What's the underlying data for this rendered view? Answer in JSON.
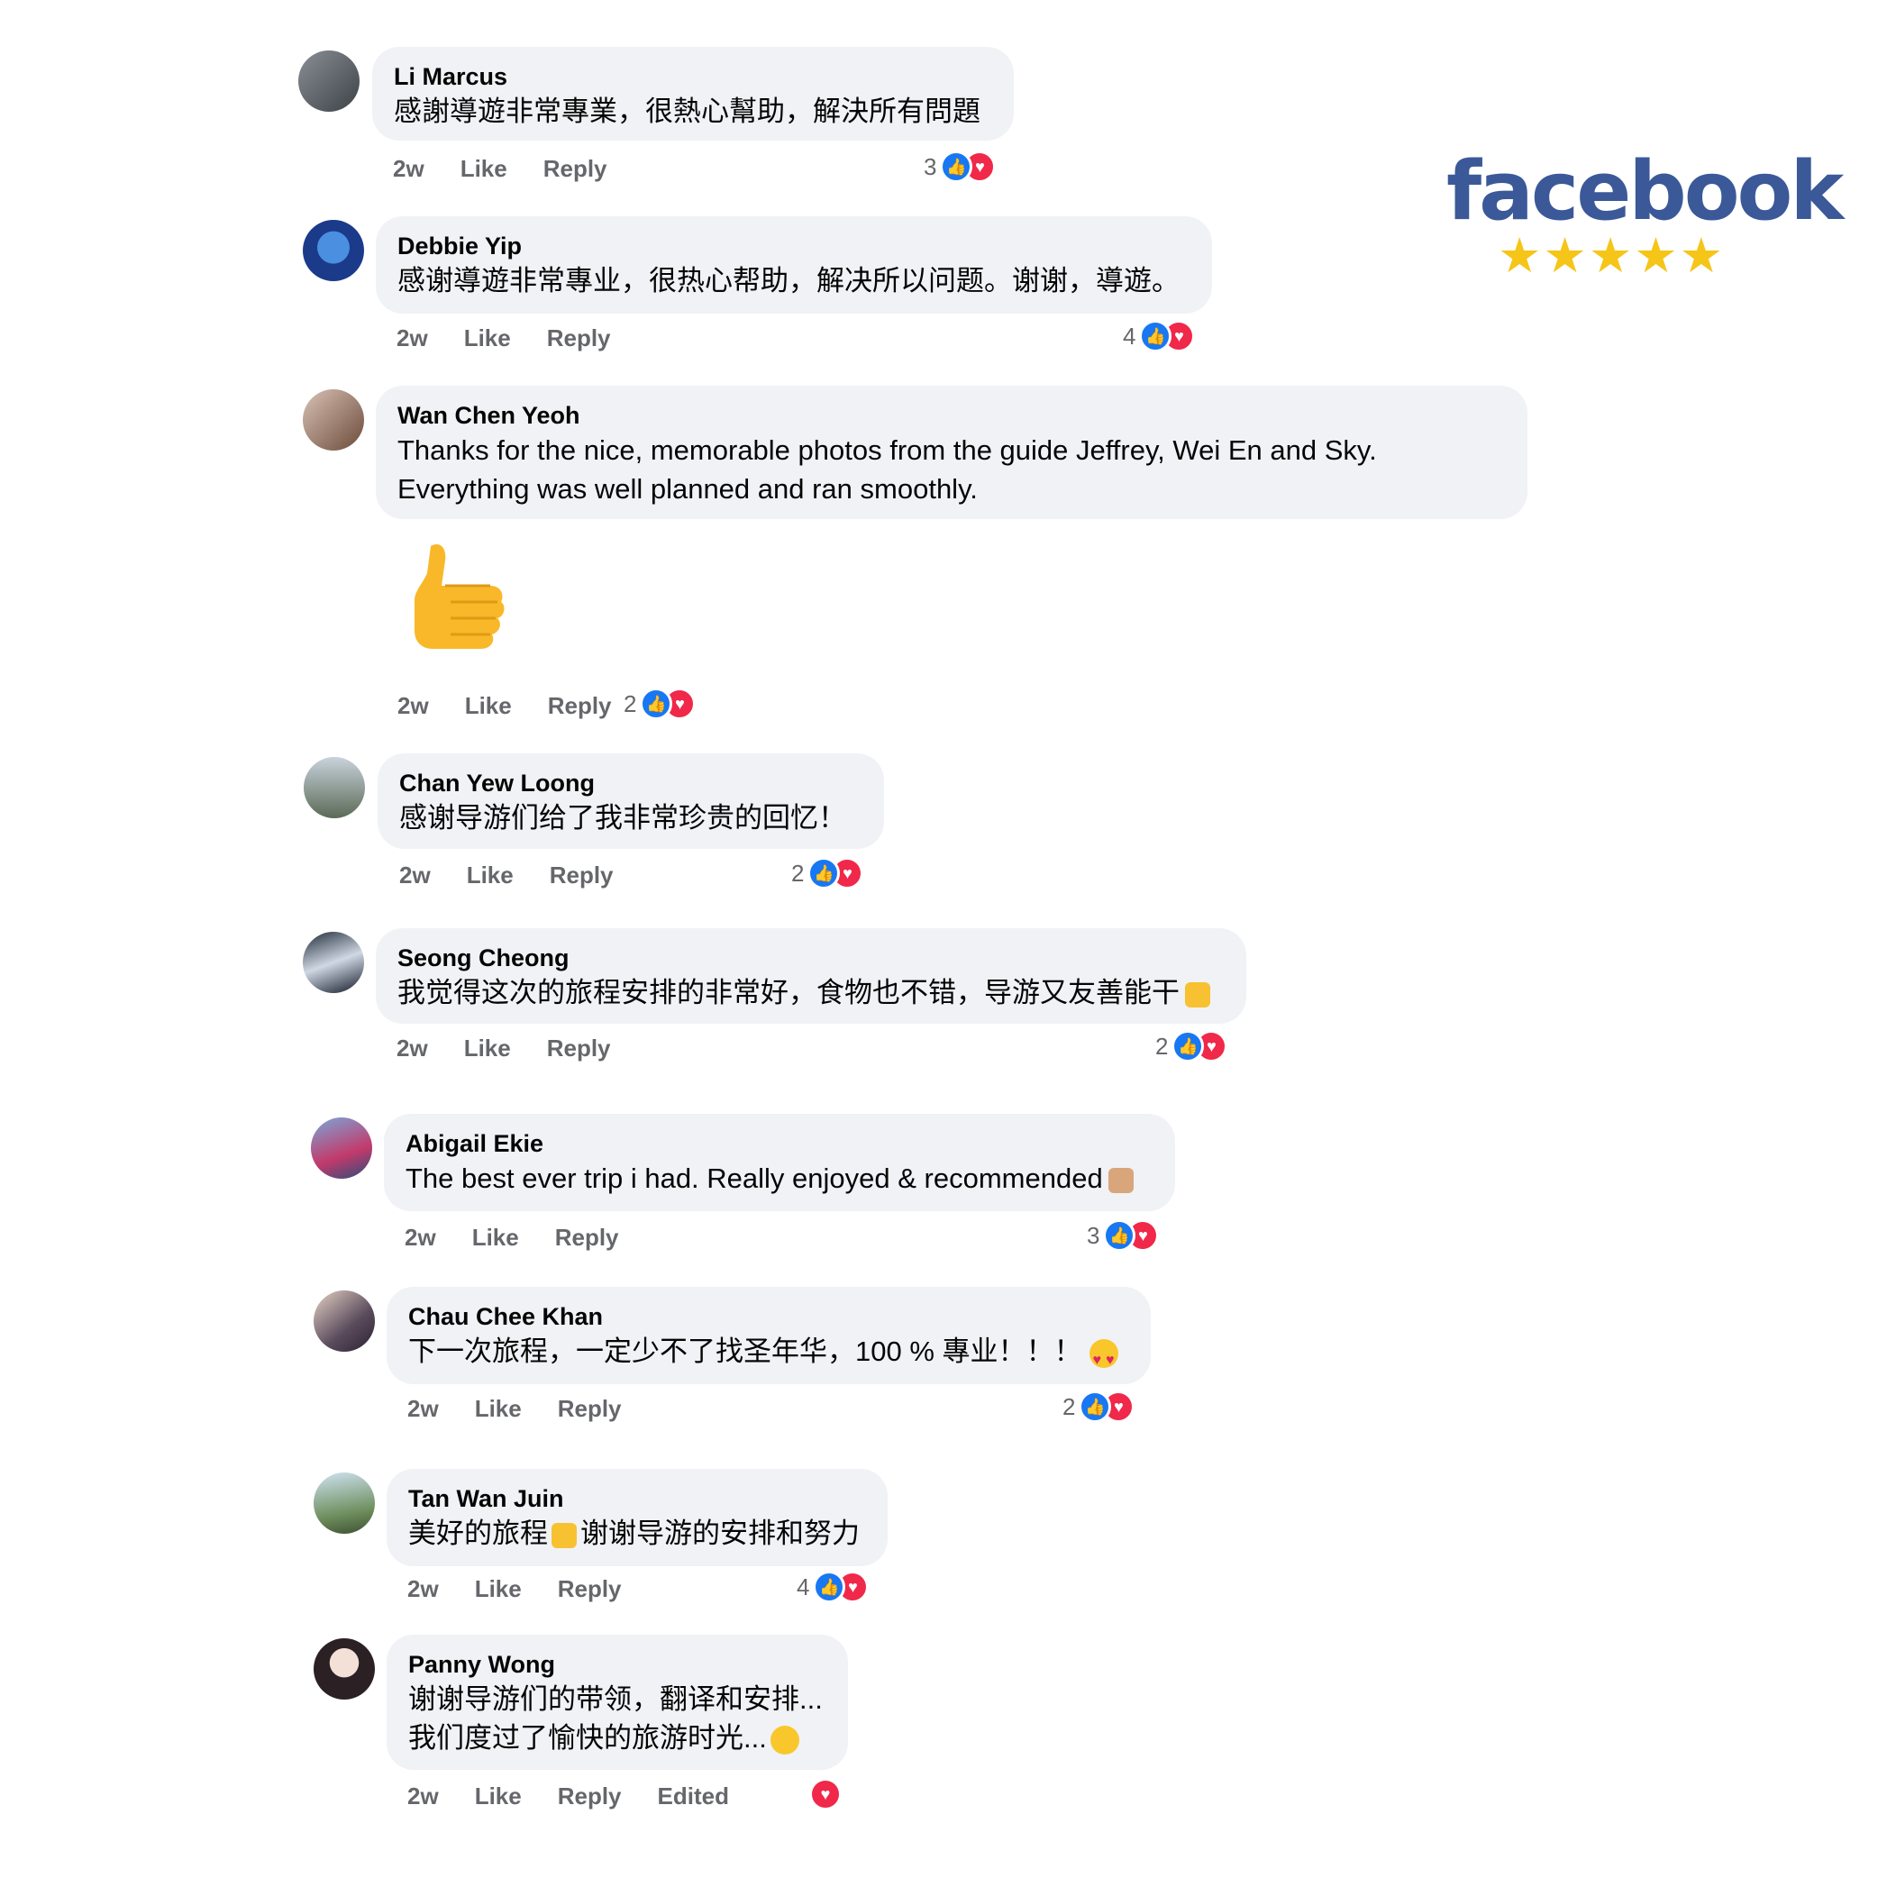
{
  "brand": {
    "logo_text": "facebook",
    "stars": "★★★★★",
    "rating": 5,
    "logo_color": "#3b5998",
    "star_color": "#f5c518"
  },
  "labels": {
    "time": "2w",
    "like": "Like",
    "reply": "Reply",
    "edited": "Edited"
  },
  "comments": [
    {
      "author": "Li Marcus",
      "lines": [
        "感謝導遊非常專業，很熱心幫助，解決所有問題"
      ],
      "time": "2w",
      "reactions": "3"
    },
    {
      "author": "Debbie Yip",
      "lines": [
        "感谢導遊非常專业，很热心帮助，解决所以问题。谢谢，導遊。"
      ],
      "time": "2w",
      "reactions": "4"
    },
    {
      "author": "Wan Chen Yeoh",
      "lines": [
        "Thanks for the nice, memorable photos from the guide Jeffrey, Wei En and Sky.",
        "Everything was well planned and ran smoothly."
      ],
      "time": "2w",
      "reactions": "2",
      "attachment": "thumbs-up-emoji"
    },
    {
      "author": "Chan Yew Loong",
      "lines": [
        "感谢导游们给了我非常珍贵的回忆！"
      ],
      "time": "2w",
      "reactions": "2"
    },
    {
      "author": "Seong Cheong",
      "lines": [
        "我觉得这次的旅程安排的非常好，食物也不错，导游又友善能干"
      ],
      "time": "2w",
      "reactions": "2"
    },
    {
      "author": "Abigail Ekie",
      "lines": [
        "The best ever trip i had. Really enjoyed & recommended"
      ],
      "time": "2w",
      "reactions": "3"
    },
    {
      "author": "Chau Chee Khan",
      "lines": [
        "下一次旅程，一定少不了找圣年华，100 % 專业！！！"
      ],
      "time": "2w",
      "reactions": "2"
    },
    {
      "author": "Tan Wan Juin",
      "lines_a": "美好的旅程",
      "lines_b": "谢谢导游的安排和努力",
      "time": "2w",
      "reactions": "4"
    },
    {
      "author": "Panny Wong",
      "lines": [
        "谢谢导游们的带领，翻译和安排...",
        "我们度过了愉快的旅游时光..."
      ],
      "time": "2w",
      "reactions": ""
    }
  ],
  "colors": {
    "bubble": "#f0f2f5",
    "like_reaction": "#1877f2",
    "love_reaction": "#f02849",
    "meta_text": "#65676b"
  }
}
